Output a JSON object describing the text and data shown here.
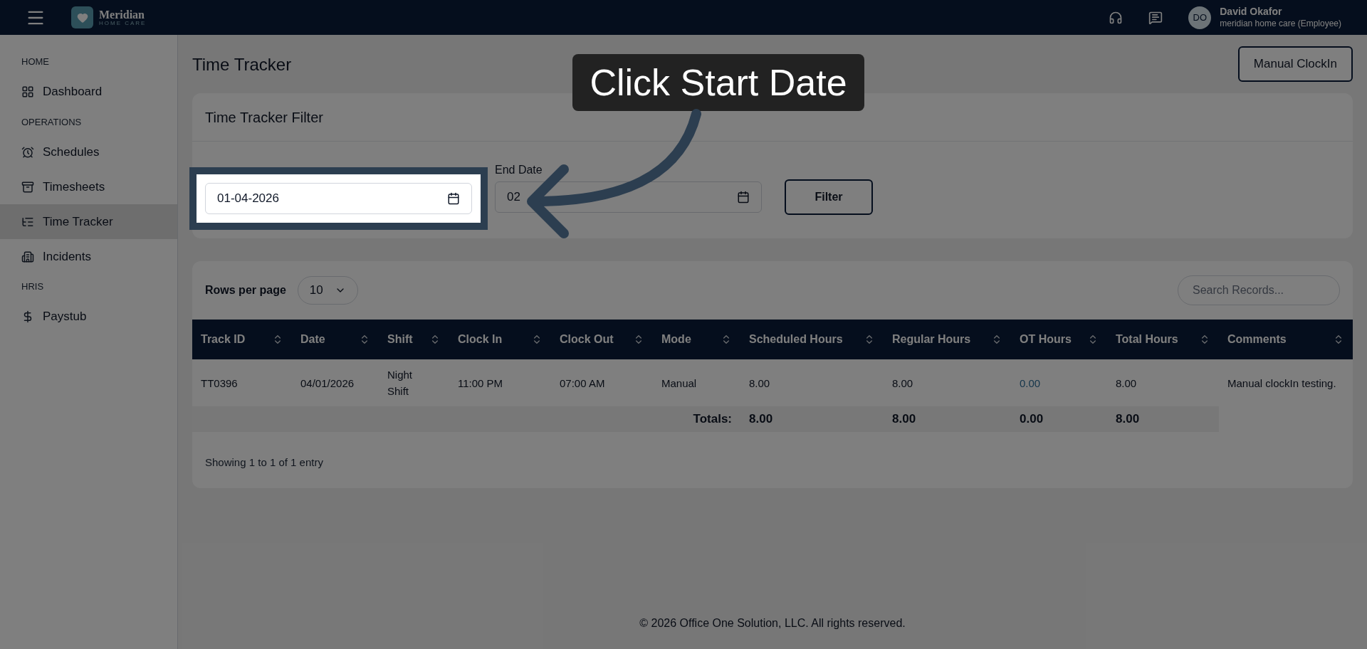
{
  "topbar": {
    "brand": "Meridian",
    "brand_sub": "HOME CARE",
    "user": {
      "initials": "DO",
      "name": "David Okafor",
      "role": "meridian home care (Employee)"
    }
  },
  "sidebar": {
    "sections": [
      {
        "title": "HOME",
        "items": [
          {
            "label": "Dashboard",
            "selected": false
          }
        ]
      },
      {
        "title": "OPERATIONS",
        "items": [
          {
            "label": "Schedules",
            "selected": false
          },
          {
            "label": "Timesheets",
            "selected": false
          },
          {
            "label": "Time Tracker",
            "selected": true
          },
          {
            "label": "Incidents",
            "selected": false
          }
        ]
      },
      {
        "title": "HRIS",
        "items": [
          {
            "label": "Paystub",
            "selected": false
          }
        ]
      }
    ]
  },
  "page": {
    "title": "Time Tracker",
    "action": "Manual ClockIn"
  },
  "filter": {
    "title": "Time Tracker Filter",
    "start": {
      "value": "01-04-2026"
    },
    "end": {
      "label": "End Date",
      "value": "02"
    },
    "button": "Filter"
  },
  "table": {
    "rows_per_page_label": "Rows per page",
    "rows_per_page": "10",
    "search": {
      "placeholder": "Search Records..."
    },
    "columns": [
      "Track ID",
      "Date",
      "Shift",
      "Clock In",
      "Clock Out",
      "Mode",
      "Scheduled Hours",
      "Regular Hours",
      "OT Hours",
      "Total Hours",
      "Comments"
    ],
    "rows": [
      {
        "cells": [
          {
            "text": "TT0396",
            "kind": "text"
          },
          {
            "text": "04/01/2026",
            "kind": "text"
          },
          {
            "text": "Night Shift",
            "kind": "text"
          },
          {
            "text": "11:00 PM",
            "kind": "text"
          },
          {
            "text": "07:00 AM",
            "kind": "text"
          },
          {
            "text": "Manual",
            "kind": "text"
          },
          {
            "text": "8.00",
            "kind": "text"
          },
          {
            "text": "8.00",
            "kind": "text"
          },
          {
            "text": "0.00",
            "kind": "link"
          },
          {
            "text": "8.00",
            "kind": "text"
          },
          {
            "text": "Manual clockIn testing.",
            "kind": "text"
          }
        ]
      }
    ],
    "totals": {
      "label": "Totals:",
      "values": [
        "8.00",
        "8.00",
        "0.00",
        "8.00"
      ]
    },
    "info": "Showing 1 to 1 of 1 entry"
  },
  "footer": "© 2026 Office One Solution, LLC. All rights reserved.",
  "tutorial": {
    "callout": "Click Start Date"
  }
}
